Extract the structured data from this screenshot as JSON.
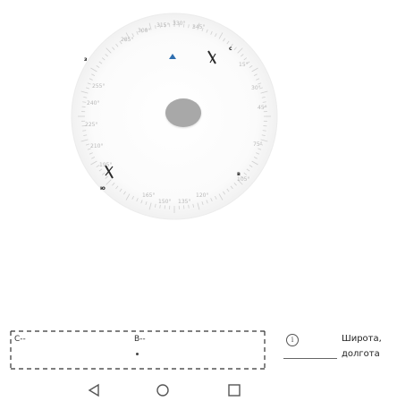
{
  "compass": {
    "cardinals": {
      "north": "с",
      "east": "в",
      "south": "ю",
      "west": "з"
    },
    "degree_labels": [
      "315°",
      "330°",
      "345°",
      "300°",
      "285°",
      "15°",
      "30°",
      "45°",
      "255°",
      "240°",
      "225°",
      "210°",
      "75°",
      "195°",
      "105°",
      "165°",
      "150°",
      "135°",
      "120°"
    ],
    "heading_arrow_color": "#2f6fb0"
  },
  "coordinates": {
    "latitude_prefix": "С--",
    "longitude_prefix": "В--",
    "placeholder_dot": "•"
  },
  "side_panel": {
    "info_glyph": "i",
    "latitude_label": "Широта,",
    "longitude_label": "долгота"
  },
  "nav": {
    "back_icon": "back-triangle-icon",
    "home_icon": "home-circle-icon",
    "recents_icon": "recents-square-icon"
  }
}
